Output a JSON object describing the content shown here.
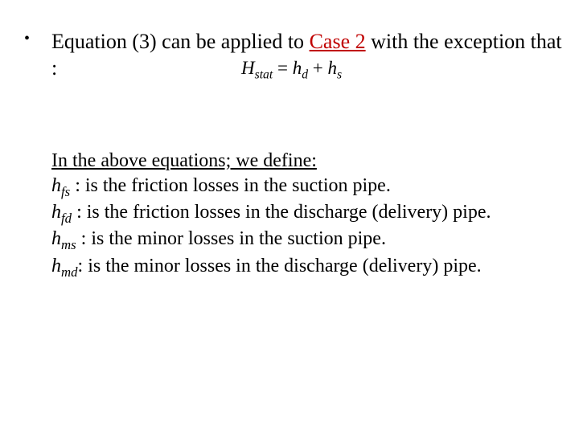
{
  "bullet": {
    "pre": "Equation (3) can be applied to  ",
    "case": "Case 2",
    "post": " with the exception that :"
  },
  "equation": {
    "lhs_var": "H",
    "lhs_sub": "stat",
    "eq": " = ",
    "r1_var": "h",
    "r1_sub": "d",
    "plus": " + ",
    "r2_var": "h",
    "r2_sub": "s"
  },
  "defs": {
    "header": "In the above equations; we define:",
    "rows": [
      {
        "var": "h",
        "sub": "fs",
        "sep": " : ",
        "text": "is the friction losses in the suction pipe."
      },
      {
        "var": "h",
        "sub": "fd",
        "sep": " : ",
        "text": "is the friction losses in the discharge (delivery) pipe."
      },
      {
        "var": "h",
        "sub": "ms",
        "sep": " : ",
        "text": "is the minor losses in the suction pipe."
      },
      {
        "var": "h",
        "sub": "md",
        "sep": ": ",
        "text": "is the minor losses in the discharge (delivery) pipe."
      }
    ]
  }
}
